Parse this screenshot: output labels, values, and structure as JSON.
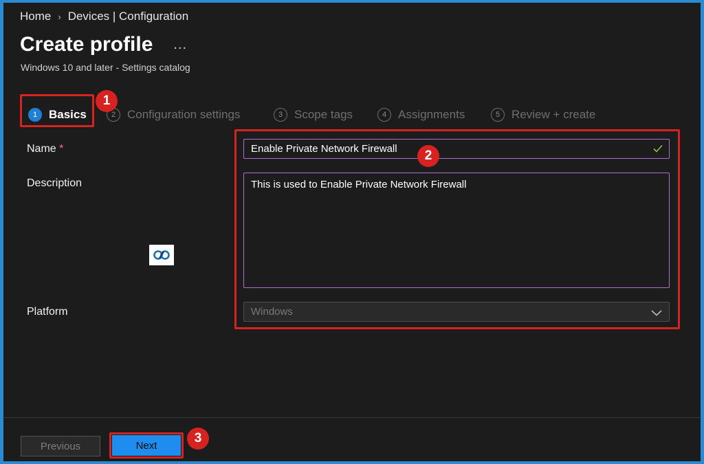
{
  "breadcrumb": {
    "home": "Home",
    "current": "Devices | Configuration"
  },
  "header": {
    "title": "Create profile",
    "more": "...",
    "subtitle": "Windows 10 and later - Settings catalog"
  },
  "steps": [
    {
      "number": "1",
      "label": "Basics",
      "active": true
    },
    {
      "number": "2",
      "label": "Configuration settings",
      "active": false
    },
    {
      "number": "3",
      "label": "Scope tags",
      "active": false
    },
    {
      "number": "4",
      "label": "Assignments",
      "active": false
    },
    {
      "number": "5",
      "label": "Review + create",
      "active": false
    }
  ],
  "form": {
    "name_label": "Name",
    "required_mark": "*",
    "name_value": "Enable Private Network Firewall",
    "description_label": "Description",
    "description_value": "This is used to Enable Private Network Firewall",
    "platform_label": "Platform",
    "platform_value": "Windows"
  },
  "annotations": {
    "badge1": "1",
    "badge2": "2",
    "badge3": "3"
  },
  "footer": {
    "previous_label": "Previous",
    "next_label": "Next"
  },
  "colors": {
    "accent": "#1f8cf0",
    "annotation": "#d72222",
    "input_border": "#b36bd6",
    "valid_check": "#8bc34a",
    "background": "#1c1c1c"
  },
  "icons": {
    "more": "ellipsis-icon",
    "valid": "checkmark-icon",
    "dropdown": "chevron-down-icon",
    "logo": "site-logo-icon"
  }
}
